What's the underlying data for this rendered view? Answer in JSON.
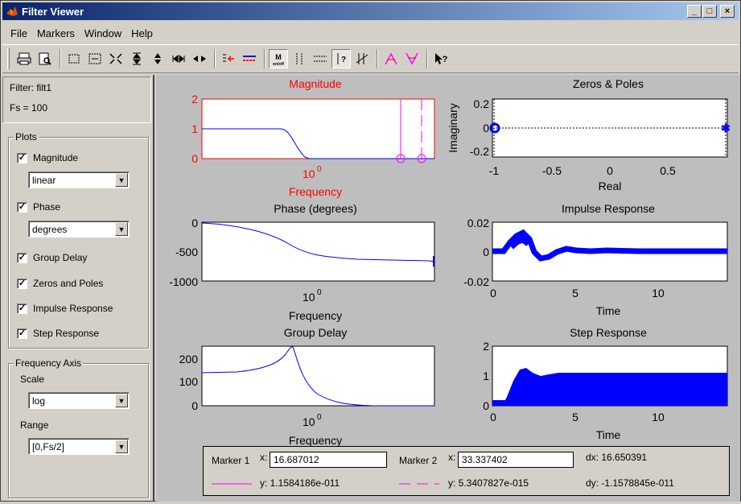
{
  "window": {
    "title": "Filter Viewer",
    "btn_min": "_",
    "btn_max": "□",
    "btn_close": "×"
  },
  "menu": [
    "File",
    "Markers",
    "Window",
    "Help"
  ],
  "filter": {
    "name": "Filter: filt1",
    "fs": "Fs = 100"
  },
  "plots": {
    "group": "Plots",
    "items": [
      {
        "label": "Magnitude",
        "checked": true,
        "select": "linear"
      },
      {
        "label": "Phase",
        "checked": true,
        "select": "degrees"
      },
      {
        "label": "Group Delay",
        "checked": true
      },
      {
        "label": "Zeros and Poles",
        "checked": true
      },
      {
        "label": "Impulse Response",
        "checked": true
      },
      {
        "label": "Step Response",
        "checked": true
      }
    ]
  },
  "freqaxis": {
    "group": "Frequency Axis",
    "scale_label": "Scale",
    "scale_value": "log",
    "range_label": "Range",
    "range_value": "[0,Fs/2]"
  },
  "colors": {
    "line": "#0000ff",
    "selected": "#ff0000",
    "marker": "#ff00ff",
    "impulse": "#0000ff"
  },
  "chart_data": [
    {
      "id": "magnitude",
      "type": "line",
      "title": "Magnitude",
      "xlabel": "Frequency",
      "ylabel": "",
      "yticks": [
        "0",
        "1",
        "2"
      ],
      "xticks": [
        "10"
      ],
      "xtick_exp": "0",
      "selected": true
    },
    {
      "id": "zeros-poles",
      "type": "scatter",
      "title": "Zeros & Poles",
      "xlabel": "Real",
      "ylabel": "Imaginary",
      "yticks": [
        "0.2",
        "0",
        "-0.2"
      ],
      "xticks": [
        "-1",
        "-0.5",
        "0",
        "0.5"
      ]
    },
    {
      "id": "phase",
      "type": "line",
      "title": "Phase (degrees)",
      "xlabel": "Frequency",
      "ylabel": "",
      "yticks": [
        "0",
        "-500",
        "-1000"
      ],
      "xticks": [
        "10"
      ],
      "xtick_exp": "0"
    },
    {
      "id": "impulse",
      "type": "line",
      "title": "Impulse Response",
      "xlabel": "Time",
      "ylabel": "",
      "yticks": [
        "0.02",
        "0",
        "-0.02"
      ],
      "xticks": [
        "0",
        "5",
        "10"
      ]
    },
    {
      "id": "group-delay",
      "type": "line",
      "title": "Group Delay",
      "xlabel": "Frequency",
      "ylabel": "",
      "yticks": [
        "200",
        "100",
        "0"
      ],
      "xticks": [
        "10"
      ],
      "xtick_exp": "0"
    },
    {
      "id": "step",
      "type": "line",
      "title": "Step Response",
      "xlabel": "Time",
      "ylabel": "",
      "yticks": [
        "2",
        "1",
        "0"
      ],
      "xticks": [
        "0",
        "5",
        "10"
      ]
    }
  ],
  "markers": {
    "m1_label": "Marker 1",
    "m1_x_label": "x:",
    "m1_x": "16.687012",
    "m1_y": "y: 1.1584186e-011",
    "m2_label": "Marker 2",
    "m2_x_label": "x:",
    "m2_x": "33.337402",
    "m2_y": "y: 5.3407827e-015",
    "dx": "dx: 16.650391",
    "dy": "dy: -1.1578845e-011"
  }
}
